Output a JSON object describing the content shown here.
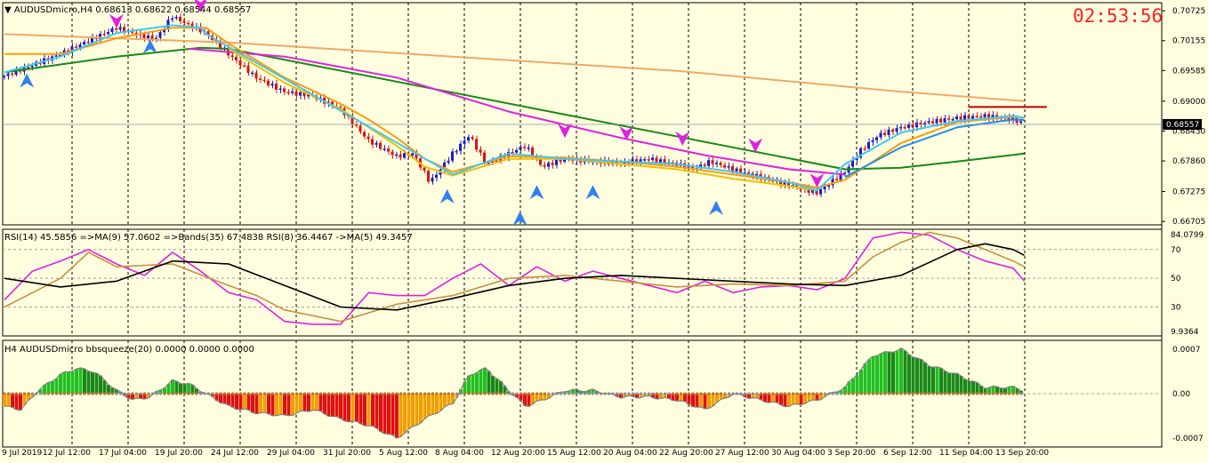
{
  "header": {
    "main_label": "▼ AUDUSDmicro,H4  0.68613 0.68622 0.68544 0.68557",
    "clock": "02:53:56",
    "rsi_label": "RSI(14) 45.5856  =>MA(9) 57.0602  =>Bands(35) 67.4838  RSI(8) 36.4467  ->MA(5) 49.3457",
    "bbs_label": "H4 AUDUSDmicro bbsqueeze(20) 0.0000 0.0000 0.0000"
  },
  "colors": {
    "background": "#ffffe0",
    "bull": "#1a1ad0",
    "bear": "#e01010",
    "ma_fast_light": "#40c8f0",
    "ma_fast_blue": "#2090e8",
    "ma_orange": "#ff9a10",
    "ma_yellow": "#f0c000",
    "ma_green": "#168a16",
    "ma_magenta": "#e020e0",
    "ma_sand": "#f0a868",
    "rsi_fast": "#e020e0",
    "rsi_ma": "#c89040",
    "rsi_slow": "#000000",
    "hist_green": "#20c020",
    "hist_red": "#e01010",
    "hist_orange": "#f0a000",
    "price_tag": "#000000",
    "level_line": "#c00000"
  },
  "chart_data": [
    {
      "type": "candlestick",
      "title": "AUDUSDmicro,H4",
      "ohlc_last": {
        "open": 0.68613,
        "high": 0.68622,
        "low": 0.68544,
        "close": 0.68557
      },
      "current_price": "0.68557",
      "price_ticks": [
        "0.70725",
        "0.70155",
        "0.69585",
        "0.69000",
        "0.68430",
        "0.67860",
        "0.67275",
        "0.66705"
      ],
      "ylim": [
        0.6664,
        0.7088
      ],
      "x_tick_labels": [
        "9 Jul 2019",
        "12 Jul 12:00",
        "17 Jul 04:00",
        "19 Jul 20:00",
        "24 Jul 12:00",
        "29 Jul 04:00",
        "31 Jul 20:00",
        "5 Aug 12:00",
        "8 Aug 04:00",
        "12 Aug 20:00",
        "15 Aug 12:00",
        "20 Aug 04:00",
        "22 Aug 20:00",
        "27 Aug 12:00",
        "30 Aug 04:00",
        "3 Sep 20:00",
        "6 Sep 12:00",
        "11 Sep 04:00",
        "13 Sep 20:00"
      ],
      "price_path": [
        [
          0,
          0.6948
        ],
        [
          1,
          0.699
        ],
        [
          2,
          0.704
        ],
        [
          2.3,
          0.703
        ],
        [
          2.7,
          0.7018
        ],
        [
          3,
          0.7062
        ],
        [
          3.3,
          0.7045
        ],
        [
          3.6,
          0.703
        ],
        [
          4,
          0.699
        ],
        [
          4.5,
          0.6945
        ],
        [
          5,
          0.6918
        ],
        [
          5.5,
          0.691
        ],
        [
          6,
          0.6885
        ],
        [
          6.5,
          0.6825
        ],
        [
          7,
          0.6795
        ],
        [
          7.3,
          0.68
        ],
        [
          7.6,
          0.6745
        ],
        [
          8,
          0.68
        ],
        [
          8.3,
          0.6835
        ],
        [
          8.6,
          0.678
        ],
        [
          9,
          0.68
        ],
        [
          9.3,
          0.6815
        ],
        [
          9.6,
          0.6775
        ],
        [
          10,
          0.679
        ],
        [
          10.5,
          0.6785
        ],
        [
          11,
          0.6782
        ],
        [
          11.5,
          0.679
        ],
        [
          12,
          0.678
        ],
        [
          12.3,
          0.677
        ],
        [
          12.6,
          0.6785
        ],
        [
          13,
          0.677
        ],
        [
          13.5,
          0.6755
        ],
        [
          14,
          0.674
        ],
        [
          14.5,
          0.6725
        ],
        [
          15,
          0.6765
        ],
        [
          15.3,
          0.6808
        ],
        [
          15.6,
          0.6835
        ],
        [
          16,
          0.685
        ],
        [
          16.5,
          0.686
        ],
        [
          17,
          0.6868
        ],
        [
          17.5,
          0.6872
        ],
        [
          18,
          0.6866
        ],
        [
          18.2,
          0.6856
        ]
      ],
      "moving_averages": [
        {
          "color": "#f0a868",
          "points": [
            [
              0,
              0.7028
            ],
            [
              4,
              0.7012
            ],
            [
              8,
              0.6985
            ],
            [
              12,
              0.6958
            ],
            [
              16,
              0.6918
            ],
            [
              18.2,
              0.69
            ]
          ]
        },
        {
          "color": "#168a16",
          "points": [
            [
              0,
              0.6955
            ],
            [
              2,
              0.6985
            ],
            [
              3.5,
              0.7002
            ],
            [
              4,
              0.7
            ],
            [
              15,
              0.677
            ],
            [
              16,
              0.6773
            ],
            [
              17,
              0.6785
            ],
            [
              18.2,
              0.68
            ]
          ]
        },
        {
          "color": "#e020e0",
          "points": [
            [
              3.3,
              0.7
            ],
            [
              5,
              0.6985
            ],
            [
              7,
              0.6945
            ],
            [
              9,
              0.688
            ],
            [
              11,
              0.683
            ],
            [
              12.5,
              0.6797
            ],
            [
              14,
              0.677
            ],
            [
              15,
              0.676
            ]
          ]
        },
        {
          "color": "#ff9a10",
          "points": [
            [
              0,
              0.699
            ],
            [
              1,
              0.699
            ],
            [
              2,
              0.702
            ],
            [
              3,
              0.704
            ],
            [
              3.6,
              0.704
            ],
            [
              4,
              0.701
            ],
            [
              5,
              0.6945
            ],
            [
              6,
              0.6895
            ],
            [
              6.5,
              0.6865
            ],
            [
              7,
              0.683
            ],
            [
              7.5,
              0.679
            ],
            [
              8,
              0.6765
            ],
            [
              9,
              0.6795
            ],
            [
              10,
              0.6792
            ],
            [
              11,
              0.6785
            ],
            [
              12,
              0.6775
            ],
            [
              13,
              0.676
            ],
            [
              14,
              0.6745
            ],
            [
              14.5,
              0.6735
            ],
            [
              15,
              0.675
            ],
            [
              16,
              0.682
            ],
            [
              17,
              0.686
            ],
            [
              18,
              0.687
            ],
            [
              18.2,
              0.6868
            ]
          ]
        },
        {
          "color": "#f0c000",
          "points": [
            [
              4,
              0.7
            ],
            [
              5,
              0.6935
            ],
            [
              6,
              0.6885
            ],
            [
              7,
              0.6815
            ],
            [
              7.5,
              0.6775
            ],
            [
              8,
              0.6758
            ],
            [
              9,
              0.679
            ],
            [
              10,
              0.679
            ],
            [
              11,
              0.678
            ],
            [
              12,
              0.677
            ],
            [
              13,
              0.6752
            ],
            [
              14,
              0.6738
            ],
            [
              14.5,
              0.673
            ]
          ]
        },
        {
          "color": "#40c8f0",
          "points": [
            [
              0,
              0.6955
            ],
            [
              1,
              0.6985
            ],
            [
              2,
              0.703
            ],
            [
              3,
              0.7045
            ],
            [
              3.5,
              0.704
            ],
            [
              3.6,
              0.7028
            ],
            [
              8,
              0.676
            ],
            [
              9,
              0.68
            ],
            [
              10,
              0.679
            ],
            [
              11,
              0.6785
            ],
            [
              12,
              0.678
            ],
            [
              13,
              0.6765
            ],
            [
              14,
              0.6745
            ],
            [
              14.5,
              0.673
            ],
            [
              15,
              0.678
            ],
            [
              16,
              0.684
            ],
            [
              17,
              0.6862
            ],
            [
              18,
              0.6872
            ],
            [
              18.2,
              0.6868
            ]
          ]
        },
        {
          "color": "#2090e8",
          "points": [
            [
              15,
              0.6755
            ],
            [
              16,
              0.6812
            ],
            [
              17,
              0.685
            ],
            [
              18,
              0.6865
            ],
            [
              18.2,
              0.6864
            ]
          ]
        }
      ],
      "level_line": {
        "price": 0.6889,
        "x_range": [
          17.2,
          18.6
        ],
        "color": "#c00000"
      },
      "arrows_up": [
        [
          0.4,
          0.6953
        ],
        [
          2.6,
          0.7018
        ],
        [
          7.9,
          0.6732
        ],
        [
          9.2,
          0.669
        ],
        [
          9.5,
          0.674
        ],
        [
          10.5,
          0.674
        ],
        [
          12.7,
          0.671
        ]
      ],
      "arrows_down": [
        [
          2.0,
          0.7039
        ],
        [
          3.5,
          0.707
        ],
        [
          10.0,
          0.683
        ],
        [
          11.1,
          0.6825
        ],
        [
          12.1,
          0.6815
        ],
        [
          13.4,
          0.6802
        ],
        [
          14.5,
          0.6735
        ]
      ]
    },
    {
      "type": "line",
      "title": "RSI(14) 45.5856  =>MA(9) 57.0602  =>Bands(35) 67.4838  RSI(8) 36.4467  ->MA(5) 49.3457",
      "y_tick_labels": [
        "84.0799",
        "70",
        "50",
        "30",
        "9.9364"
      ],
      "ylim": [
        9.9364,
        84.0799
      ],
      "levels": [
        70,
        50,
        30
      ],
      "series": [
        {
          "color": "#e020e0",
          "values": [
            [
              0,
              35
            ],
            [
              0.5,
              55
            ],
            [
              1,
              62
            ],
            [
              1.5,
              70
            ],
            [
              2,
              60
            ],
            [
              2.5,
              52
            ],
            [
              3,
              68
            ],
            [
              3.5,
              55
            ],
            [
              4,
              40
            ],
            [
              4.5,
              35
            ],
            [
              5,
              20
            ],
            [
              5.5,
              18
            ],
            [
              6,
              18
            ],
            [
              6.5,
              40
            ],
            [
              7,
              38
            ],
            [
              7.5,
              38
            ],
            [
              8,
              50
            ],
            [
              8.5,
              60
            ],
            [
              9,
              45
            ],
            [
              9.5,
              58
            ],
            [
              10,
              48
            ],
            [
              10.5,
              55
            ],
            [
              11,
              50
            ],
            [
              11.5,
              45
            ],
            [
              12,
              40
            ],
            [
              12.5,
              48
            ],
            [
              13,
              40
            ],
            [
              13.5,
              44
            ],
            [
              14,
              45
            ],
            [
              14.5,
              42
            ],
            [
              15,
              50
            ],
            [
              15.5,
              78
            ],
            [
              16,
              82
            ],
            [
              16.5,
              80
            ],
            [
              17,
              70
            ],
            [
              17.5,
              62
            ],
            [
              18,
              57
            ],
            [
              18.2,
              48
            ]
          ]
        },
        {
          "color": "#c89040",
          "values": [
            [
              0,
              30
            ],
            [
              1,
              50
            ],
            [
              1.5,
              68
            ],
            [
              2,
              58
            ],
            [
              3,
              60
            ],
            [
              4,
              45
            ],
            [
              4.5,
              38
            ],
            [
              5,
              28
            ],
            [
              6,
              20
            ],
            [
              7,
              32
            ],
            [
              8,
              38
            ],
            [
              9,
              50
            ],
            [
              10,
              52
            ],
            [
              11,
              48
            ],
            [
              12,
              44
            ],
            [
              13,
              46
            ],
            [
              14,
              45
            ],
            [
              15,
              48
            ],
            [
              15.5,
              65
            ],
            [
              16,
              75
            ],
            [
              16.5,
              82
            ],
            [
              17,
              78
            ],
            [
              17.5,
              70
            ],
            [
              18,
              62
            ],
            [
              18.2,
              58
            ]
          ]
        },
        {
          "color": "#000000",
          "values": [
            [
              0,
              50
            ],
            [
              1,
              44
            ],
            [
              2,
              48
            ],
            [
              3,
              62
            ],
            [
              4,
              60
            ],
            [
              5,
              45
            ],
            [
              6,
              30
            ],
            [
              7,
              28
            ],
            [
              8,
              36
            ],
            [
              9,
              45
            ],
            [
              10,
              50
            ],
            [
              11,
              52
            ],
            [
              12,
              50
            ],
            [
              13,
              48
            ],
            [
              14,
              46
            ],
            [
              15,
              45
            ],
            [
              16,
              52
            ],
            [
              17,
              70
            ],
            [
              17.5,
              74
            ],
            [
              18,
              70
            ],
            [
              18.2,
              66
            ]
          ]
        }
      ]
    },
    {
      "type": "bar",
      "title": "H4 AUDUSDmicro bbsqueeze(20) 0.0000 0.0000 0.0000",
      "y_tick_labels": [
        "0.0007",
        "0.00",
        "-0.0007"
      ],
      "ylim": [
        -0.0007,
        0.0007
      ],
      "histogram": [
        [
          0,
          -0.0002
        ],
        [
          0.3,
          -0.00025
        ],
        [
          0.6,
          5e-05
        ],
        [
          1,
          0.0003
        ],
        [
          1.3,
          0.0004
        ],
        [
          1.6,
          0.00035
        ],
        [
          2,
          5e-05
        ],
        [
          2.3,
          -0.0001
        ],
        [
          2.6,
          -5e-05
        ],
        [
          3,
          0.0002
        ],
        [
          3.3,
          0.00015
        ],
        [
          3.6,
          0.0
        ],
        [
          4,
          -0.0002
        ],
        [
          4.5,
          -0.0003
        ],
        [
          5,
          -0.00035
        ],
        [
          5.5,
          -0.00025
        ],
        [
          6,
          -0.0004
        ],
        [
          6.5,
          -0.0005
        ],
        [
          7,
          -0.0007
        ],
        [
          7.5,
          -0.0004
        ],
        [
          8,
          -0.00015
        ],
        [
          8.3,
          0.0003
        ],
        [
          8.6,
          0.0004
        ],
        [
          9,
          5e-05
        ],
        [
          9.3,
          -0.0002
        ],
        [
          9.6,
          -0.0001
        ],
        [
          10,
          5e-05
        ],
        [
          10.5,
          5e-05
        ],
        [
          11,
          -5e-05
        ],
        [
          11.5,
          -5e-05
        ],
        [
          12,
          -0.0001
        ],
        [
          12.5,
          -0.00025
        ],
        [
          13,
          0.0
        ],
        [
          13.5,
          -0.0001
        ],
        [
          14,
          -0.0002
        ],
        [
          14.5,
          -0.0001
        ],
        [
          15,
          0.0001
        ],
        [
          15.5,
          0.0006
        ],
        [
          16,
          0.0007
        ],
        [
          16.5,
          0.00045
        ],
        [
          17,
          0.0003
        ],
        [
          17.5,
          0.0001
        ],
        [
          18,
          0.0001
        ],
        [
          18.2,
          5e-05
        ]
      ]
    }
  ]
}
